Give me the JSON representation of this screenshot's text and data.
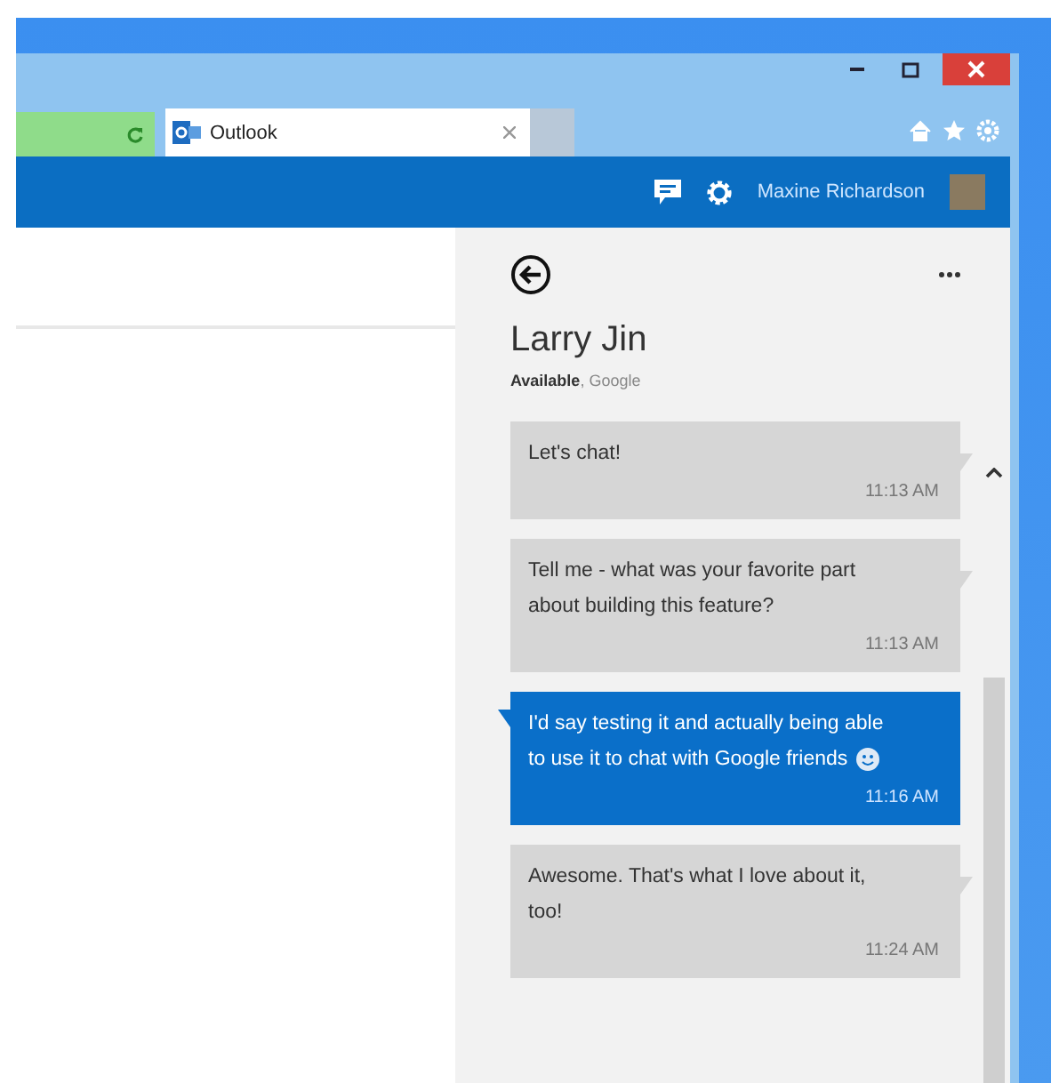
{
  "browser": {
    "tabs": [
      {
        "label": "Outlook",
        "selected": true
      }
    ]
  },
  "app_bar": {
    "user_name": "Maxine Richardson"
  },
  "chat": {
    "contact_name": "Larry Jin",
    "status": "**Available**, Google",
    "messages": [
      {
        "kind": "incoming",
        "text": "Let's chat!",
        "time": "11:13 AM",
        "emoji": false
      },
      {
        "kind": "incoming",
        "text": "Tell me - what was your favorite part about building this feature?",
        "time": "11:13 AM",
        "emoji": false
      },
      {
        "kind": "outgoing",
        "text": "I'd say testing it and actually being able to use it to chat with Google friends",
        "time": "11:16 AM",
        "emoji": true
      },
      {
        "kind": "incoming",
        "text": "Awesome. That's what I love about it, too!",
        "time": "11:24 AM",
        "emoji": false
      }
    ]
  }
}
